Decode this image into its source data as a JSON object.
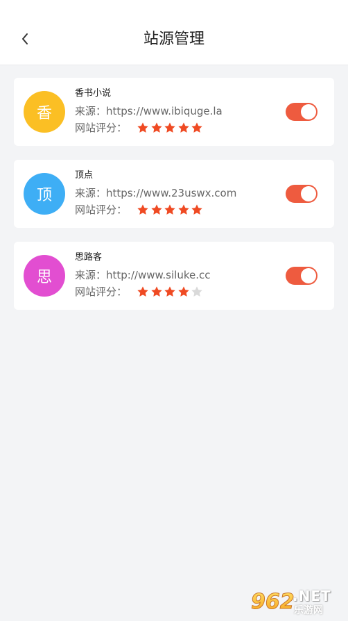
{
  "header": {
    "title": "站源管理",
    "back_icon": "chevron-left-icon"
  },
  "sources": [
    {
      "avatar_char": "香",
      "avatar_color": "#fbbf24",
      "name": "香书小说",
      "source_label": "来源：",
      "url": "https://www.ibiquge.la",
      "rating_label": "网站评分：",
      "rating": 5,
      "rating_max": 5,
      "enabled": true
    },
    {
      "avatar_char": "顶",
      "avatar_color": "#3eaef5",
      "name": "顶点",
      "source_label": "来源：",
      "url": "https://www.23uswx.com",
      "rating_label": "网站评分：",
      "rating": 5,
      "rating_max": 5,
      "enabled": true
    },
    {
      "avatar_char": "思",
      "avatar_color": "#e24ed1",
      "name": "思路客",
      "source_label": "来源：",
      "url": "http://www.siluke.cc",
      "rating_label": "网站评分：",
      "rating": 4,
      "rating_max": 5,
      "enabled": true
    }
  ],
  "colors": {
    "accent": "#ee5b3f",
    "star_active": "#ef4a23",
    "star_inactive": "#d9d9d9",
    "background": "#f3f4f6"
  },
  "watermark": {
    "digits": "962",
    "domain": ".NET",
    "text": "乐游网"
  }
}
